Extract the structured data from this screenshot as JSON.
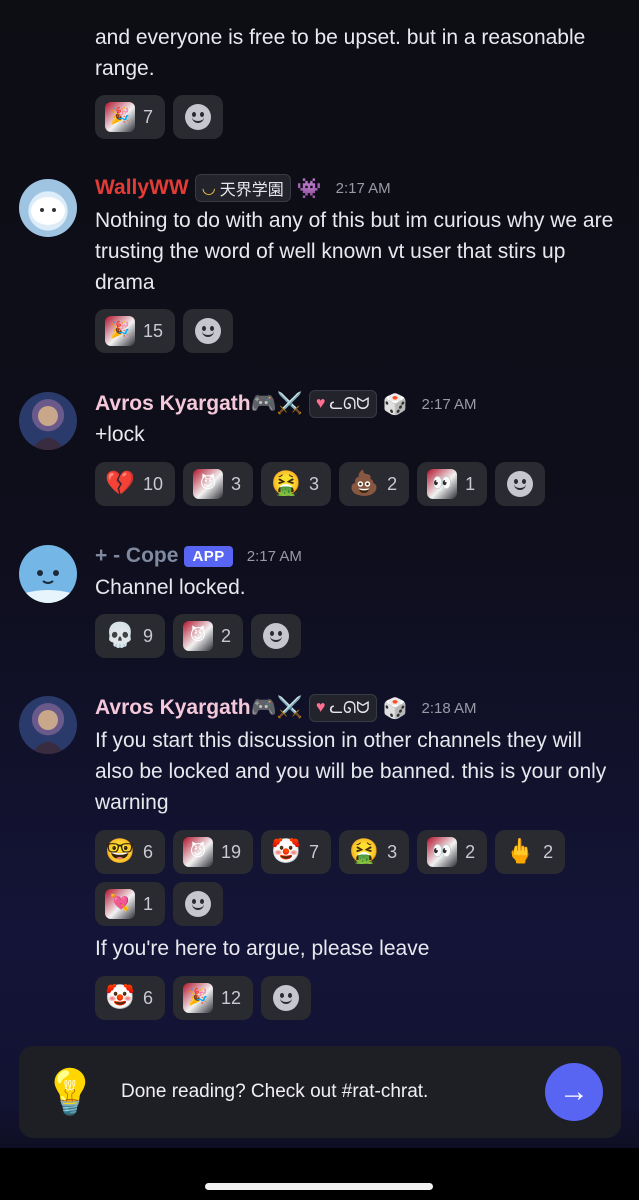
{
  "messages": [
    {
      "text": "and everyone is free to be upset. but in a reasonable range.",
      "reactions": [
        {
          "emoji": "🎉",
          "count": "7",
          "custom": true
        }
      ]
    },
    {
      "username": "WallyWW",
      "user_color": "#e33c36",
      "tag_text": "天界学園",
      "time": "2:17 AM",
      "text": "Nothing to do with any of this but im curious why we are trusting the word of well known vt user that stirs up drama",
      "reactions": [
        {
          "emoji": "🎉",
          "count": "15",
          "custom": true
        }
      ]
    },
    {
      "username": "Avros Kyargath🎮⚔️",
      "user_color": "#f4c7d9",
      "tag_text": "ᓚᘏᗢ",
      "time": "2:17 AM",
      "text": "+lock",
      "reactions": [
        {
          "emoji": "💔",
          "count": "10"
        },
        {
          "emoji": "😈",
          "count": "3",
          "custom": true
        },
        {
          "emoji": "🤮",
          "count": "3"
        },
        {
          "emoji": "💩",
          "count": "2"
        },
        {
          "emoji": "👀",
          "count": "1",
          "custom": true
        }
      ]
    },
    {
      "username": "+ - Cope",
      "user_color": "#7f8aa0",
      "app_badge": "APP",
      "time": "2:17 AM",
      "text": "Channel locked.",
      "reactions": [
        {
          "emoji": "💀",
          "count": "9"
        },
        {
          "emoji": "😈",
          "count": "2",
          "custom": true
        }
      ]
    },
    {
      "username": "Avros Kyargath🎮⚔️",
      "user_color": "#f4c7d9",
      "tag_text": "ᓚᘏᗢ",
      "time": "2:18 AM",
      "text": "If you start this discussion in other channels they will also be locked and you will be banned. this is your only warning",
      "reactions": [
        {
          "emoji": "🤓",
          "count": "6"
        },
        {
          "emoji": "😈",
          "count": "19",
          "custom": true
        },
        {
          "emoji": "🤡",
          "count": "7"
        },
        {
          "emoji": "🤮",
          "count": "3"
        },
        {
          "emoji": "👀",
          "count": "2",
          "custom": true
        },
        {
          "emoji": "🖕",
          "count": "2"
        },
        {
          "emoji": "💘",
          "count": "1",
          "custom": true
        }
      ],
      "followup_text": "If you're here to argue, please leave",
      "followup_reactions": [
        {
          "emoji": "🤡",
          "count": "6"
        },
        {
          "emoji": "🎉",
          "count": "12",
          "custom": true
        }
      ]
    }
  ],
  "banner": {
    "text": "Done reading? Check out #rat-chrat."
  },
  "icons": {
    "add_reaction": "smile-plus-icon",
    "send": "arrow-right-icon",
    "bulb": "winged-lightbulb-icon",
    "dice": "dice-icon"
  },
  "colors": {
    "accent": "#5865f2",
    "reaction_bg": "#2a2a31"
  }
}
